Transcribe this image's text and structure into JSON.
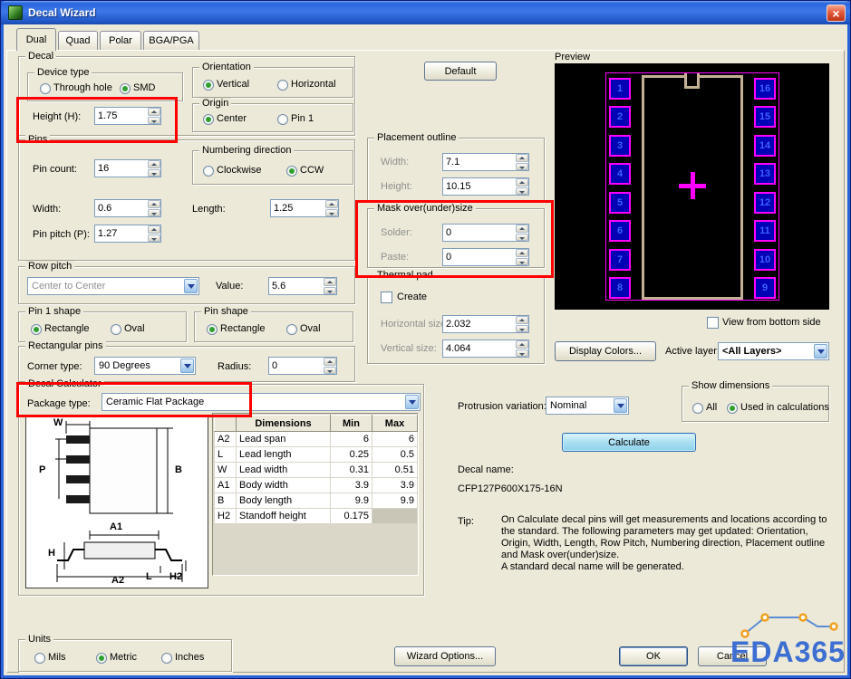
{
  "window": {
    "title": "Decal Wizard"
  },
  "tabs": [
    {
      "label": "Dual",
      "active": true
    },
    {
      "label": "Quad",
      "active": false
    },
    {
      "label": "Polar",
      "active": false
    },
    {
      "label": "BGA/PGA",
      "active": false
    }
  ],
  "decal": {
    "legend": "Decal",
    "device_type": {
      "legend": "Device type",
      "options": [
        {
          "label": "Through hole",
          "selected": false
        },
        {
          "label": "SMD",
          "selected": true
        }
      ]
    },
    "height": {
      "label": "Height (H):",
      "value": "1.75"
    },
    "orientation": {
      "legend": "Orientation",
      "options": [
        {
          "label": "Vertical",
          "selected": true
        },
        {
          "label": "Horizontal",
          "selected": false
        }
      ]
    },
    "origin": {
      "legend": "Origin",
      "options": [
        {
          "label": "Center",
          "selected": true
        },
        {
          "label": "Pin 1",
          "selected": false
        }
      ]
    }
  },
  "pins": {
    "legend": "Pins",
    "pin_count": {
      "label": "Pin count:",
      "value": "16"
    },
    "numbering": {
      "legend": "Numbering direction",
      "options": [
        {
          "label": "Clockwise",
          "selected": false
        },
        {
          "label": "CCW",
          "selected": true
        }
      ]
    },
    "width": {
      "label": "Width:",
      "value": "0.6"
    },
    "length": {
      "label": "Length:",
      "value": "1.25"
    },
    "pin_pitch": {
      "label": "Pin pitch (P):",
      "value": "1.27"
    }
  },
  "row_pitch": {
    "legend": "Row pitch",
    "mode_value": "Center to Center",
    "value_label": "Value:",
    "value": "5.6"
  },
  "pin1_shape": {
    "legend": "Pin 1 shape",
    "options": [
      {
        "label": "Rectangle",
        "selected": true
      },
      {
        "label": "Oval",
        "selected": false
      }
    ]
  },
  "pin_shape": {
    "legend": "Pin shape",
    "options": [
      {
        "label": "Rectangle",
        "selected": true
      },
      {
        "label": "Oval",
        "selected": false
      }
    ]
  },
  "rect_pins": {
    "legend": "Rectangular pins",
    "corner_label": "Corner type:",
    "corner_value": "90 Degrees",
    "radius_label": "Radius:",
    "radius_value": "0"
  },
  "calculator": {
    "legend": "Decal Calculator",
    "package_label": "Package type:",
    "package_value": "Ceramic Flat Package",
    "diagram_labels": [
      "W",
      "P",
      "B",
      "A1",
      "H",
      "A2",
      "L",
      "H2"
    ],
    "table": {
      "headers": [
        "",
        "Dimensions",
        "Min",
        "Max"
      ],
      "rows": [
        {
          "key": "A2",
          "name": "Lead span",
          "min": "6",
          "max": "6"
        },
        {
          "key": "L",
          "name": "Lead length",
          "min": "0.25",
          "max": "0.5"
        },
        {
          "key": "W",
          "name": "Lead width",
          "min": "0.31",
          "max": "0.51"
        },
        {
          "key": "A1",
          "name": "Body width",
          "min": "3.9",
          "max": "3.9"
        },
        {
          "key": "B",
          "name": "Body length",
          "min": "9.9",
          "max": "9.9"
        },
        {
          "key": "H2",
          "name": "Standoff height",
          "min": "0.175",
          "max": ""
        }
      ]
    }
  },
  "placement": {
    "legend": "Placement outline",
    "width_label": "Width:",
    "width_value": "7.1",
    "height_label": "Height:",
    "height_value": "10.15"
  },
  "mask": {
    "legend": "Mask over(under)size",
    "solder_label": "Solder:",
    "solder_value": "0",
    "paste_label": "Paste:",
    "paste_value": "0"
  },
  "thermal": {
    "legend": "Thermal pad",
    "create_label": "Create",
    "horizontal_label": "Horizontal size:",
    "horizontal_value": "2.032",
    "vertical_label": "Vertical size:",
    "vertical_value": "4.064"
  },
  "preview": {
    "label": "Preview",
    "left_pins": [
      "1",
      "2",
      "3",
      "4",
      "5",
      "6",
      "7",
      "8"
    ],
    "right_pins": [
      "16",
      "15",
      "14",
      "13",
      "12",
      "11",
      "10",
      "9"
    ],
    "view_bottom_label": "View from bottom side",
    "active_layer_label": "Active layer:",
    "active_layer_value": "<All Layers>"
  },
  "show_dimensions": {
    "legend": "Show dimensions",
    "options": [
      {
        "label": "All",
        "selected": false
      },
      {
        "label": "Used in calculations",
        "selected": true
      }
    ]
  },
  "protrusion": {
    "label": "Protrusion variation:",
    "value": "Nominal"
  },
  "decal_name": {
    "label": "Decal name:",
    "value": "CFP127P600X175-16N"
  },
  "tip": {
    "label": "Tip:",
    "text": "On Calculate decal pins will get measurements and locations according to the standard. The following parameters may get updated: Orientation, Origin, Width, Length, Row Pitch, Numbering direction, Placement outline and Mask over(under)size.\nA standard decal name will be generated."
  },
  "units": {
    "legend": "Units",
    "options": [
      {
        "label": "Mils",
        "selected": false
      },
      {
        "label": "Metric",
        "selected": true
      },
      {
        "label": "Inches",
        "selected": false
      }
    ]
  },
  "buttons": {
    "default": "Default",
    "display_colors": "Display Colors...",
    "calculate": "Calculate",
    "wizard_options": "Wizard Options...",
    "ok": "OK",
    "cancel": "Cancel"
  },
  "watermark": {
    "text": "EDA365"
  },
  "colors": {
    "annotation": "#FE0000",
    "preview_outline": "#FF00FF",
    "pin_fill": "#0000B4",
    "pin_number": "#3D62FF",
    "body_outline": "#C4B193",
    "calculate_bg": "#AADFF2",
    "title_bar": "#2A62D8"
  }
}
